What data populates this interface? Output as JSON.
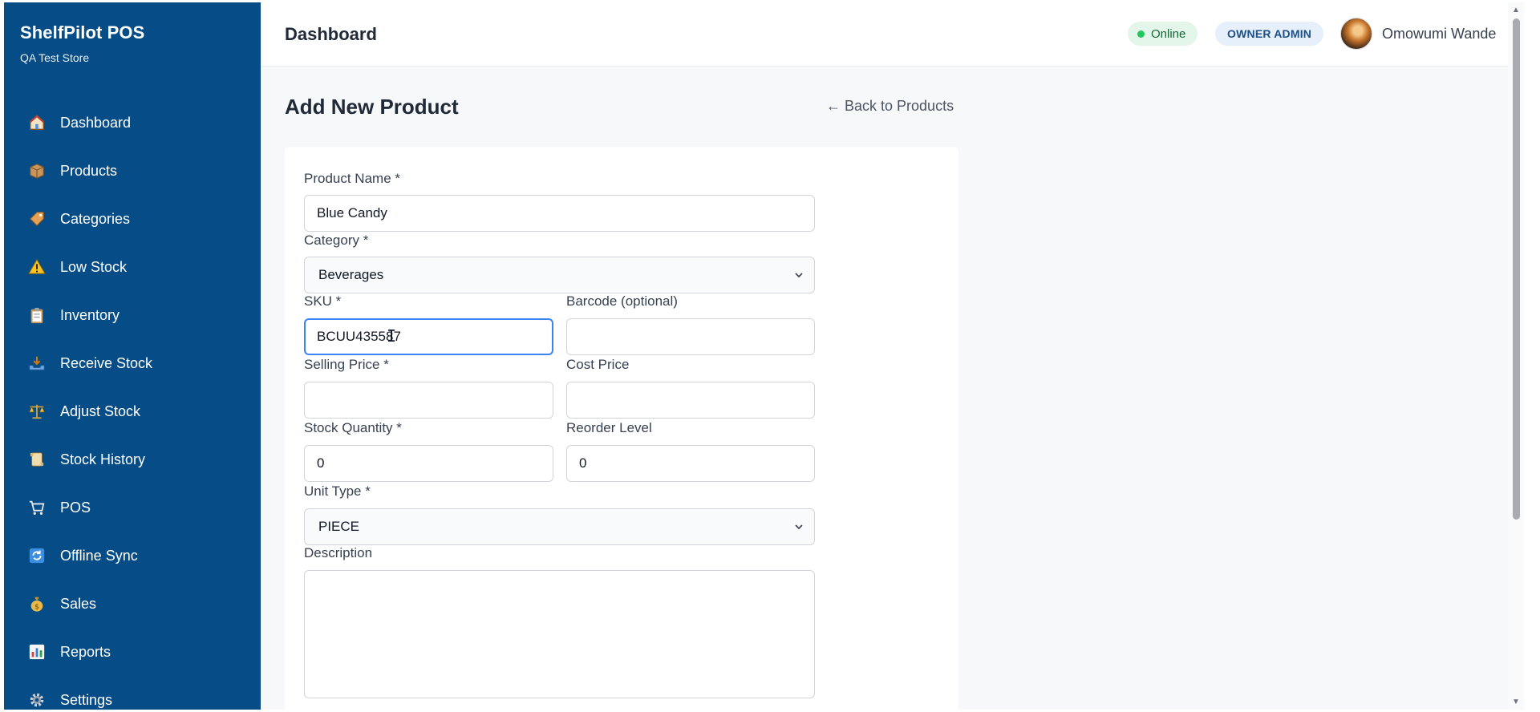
{
  "app": {
    "brand": "ShelfPilot POS",
    "store": "QA Test Store"
  },
  "sidebar": {
    "items": [
      {
        "label": "Dashboard",
        "icon": "house-icon"
      },
      {
        "label": "Products",
        "icon": "box-icon"
      },
      {
        "label": "Categories",
        "icon": "tag-icon"
      },
      {
        "label": "Low Stock",
        "icon": "warning-icon"
      },
      {
        "label": "Inventory",
        "icon": "clipboard-icon"
      },
      {
        "label": "Receive Stock",
        "icon": "inbox-tray-icon"
      },
      {
        "label": "Adjust Stock",
        "icon": "balance-scale-icon"
      },
      {
        "label": "Stock History",
        "icon": "scroll-icon"
      },
      {
        "label": "POS",
        "icon": "cart-icon"
      },
      {
        "label": "Offline Sync",
        "icon": "sync-icon"
      },
      {
        "label": "Sales",
        "icon": "money-bag-icon"
      },
      {
        "label": "Reports",
        "icon": "bar-chart-icon"
      },
      {
        "label": "Settings",
        "icon": "gear-icon"
      }
    ]
  },
  "header": {
    "title": "Dashboard",
    "status": "Online",
    "role": "OWNER ADMIN",
    "user_name": "Omowumi Wande"
  },
  "page": {
    "heading": "Add New Product",
    "back_link": "← Back to Products"
  },
  "form": {
    "product_name": {
      "label": "Product Name *",
      "value": "Blue Candy"
    },
    "category": {
      "label": "Category *",
      "value": "Beverages"
    },
    "sku": {
      "label": "SKU *",
      "value": "BCUU435587"
    },
    "barcode": {
      "label": "Barcode (optional)",
      "value": ""
    },
    "selling_price": {
      "label": "Selling Price *",
      "value": ""
    },
    "cost_price": {
      "label": "Cost Price",
      "value": ""
    },
    "stock_quantity": {
      "label": "Stock Quantity *",
      "value": "0"
    },
    "reorder_level": {
      "label": "Reorder Level",
      "value": "0"
    },
    "unit_type": {
      "label": "Unit Type *",
      "value": "PIECE"
    },
    "description": {
      "label": "Description",
      "value": ""
    }
  },
  "colors": {
    "sidebar_bg": "#064d87",
    "online_green": "#22c55e",
    "focus_blue": "#3b82f6"
  }
}
